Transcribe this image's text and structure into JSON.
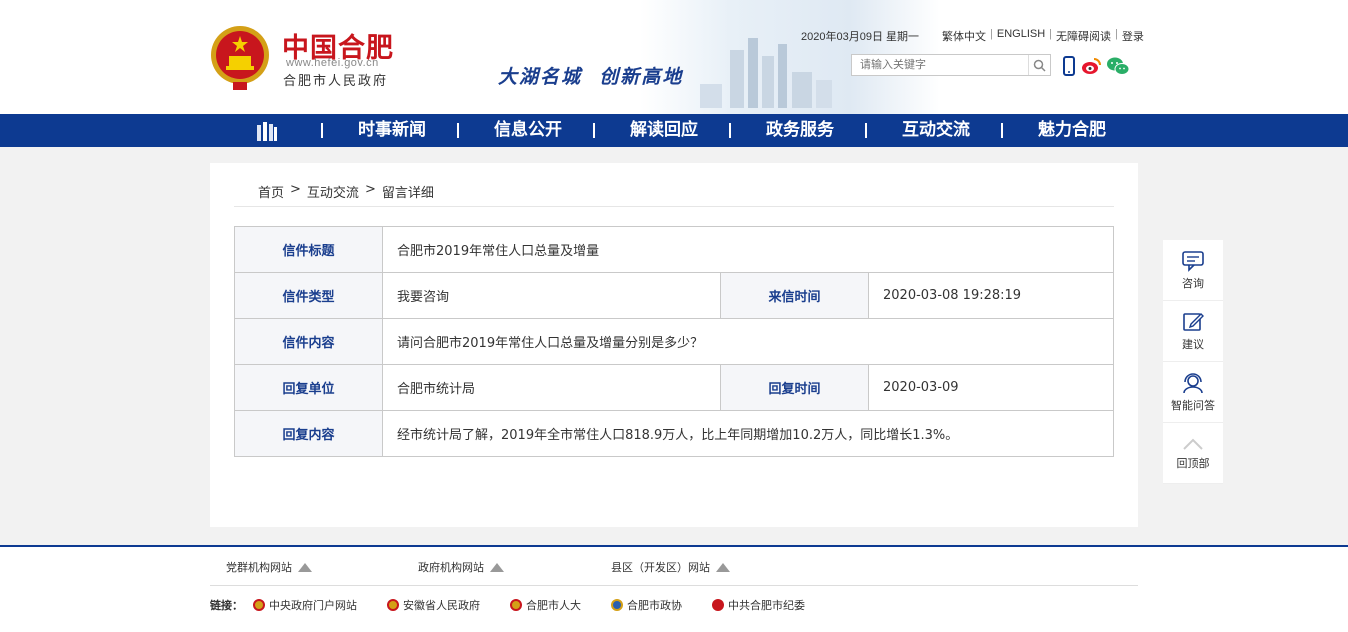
{
  "header": {
    "site_title": "中国合肥",
    "site_url": "www.hefei.gov.cn",
    "site_subtitle": "合肥市人民政府",
    "slogan": "大湖名城  创新高地",
    "date": "2020年03月09日 星期一",
    "top_links": [
      "繁体中文",
      "ENGLISH",
      "无障碍阅读",
      "登录"
    ],
    "search_placeholder": "请输入关键字"
  },
  "nav": {
    "items": [
      "时事新闻",
      "信息公开",
      "解读回应",
      "政务服务",
      "互动交流",
      "魅力合肥"
    ]
  },
  "breadcrumb": [
    "首页",
    "互动交流",
    "留言详细"
  ],
  "letter": {
    "title_label": "信件标题",
    "title_value": "合肥市2019年常住人口总量及增量",
    "type_label": "信件类型",
    "type_value": "我要咨询",
    "time_label": "来信时间",
    "time_value": "2020-03-08 19:28:19",
    "content_label": "信件内容",
    "content_value": "请问合肥市2019年常住人口总量及增量分别是多少？",
    "reply_unit_label": "回复单位",
    "reply_unit_value": "合肥市统计局",
    "reply_time_label": "回复时间",
    "reply_time_value": "2020-03-09",
    "reply_content_label": "回复内容",
    "reply_content_value": "经市统计局了解，2019年全市常住人口818.9万人，比上年同期增加10.2万人，同比增长1.3%。"
  },
  "float_bar": [
    "咨询",
    "建议",
    "智能问答",
    "回顶部"
  ],
  "footer": {
    "groups": [
      "党群机构网站",
      "政府机构网站",
      "县区（开发区）网站"
    ],
    "links_label": "链接：",
    "links": [
      "中央政府门户网站",
      "安徽省人民政府",
      "合肥市人大",
      "合肥市政协",
      "中共合肥市纪委"
    ]
  },
  "colors": {
    "brand_blue": "#0d3a91",
    "brand_red": "#c8161d",
    "label_blue": "#1a3e8e"
  }
}
